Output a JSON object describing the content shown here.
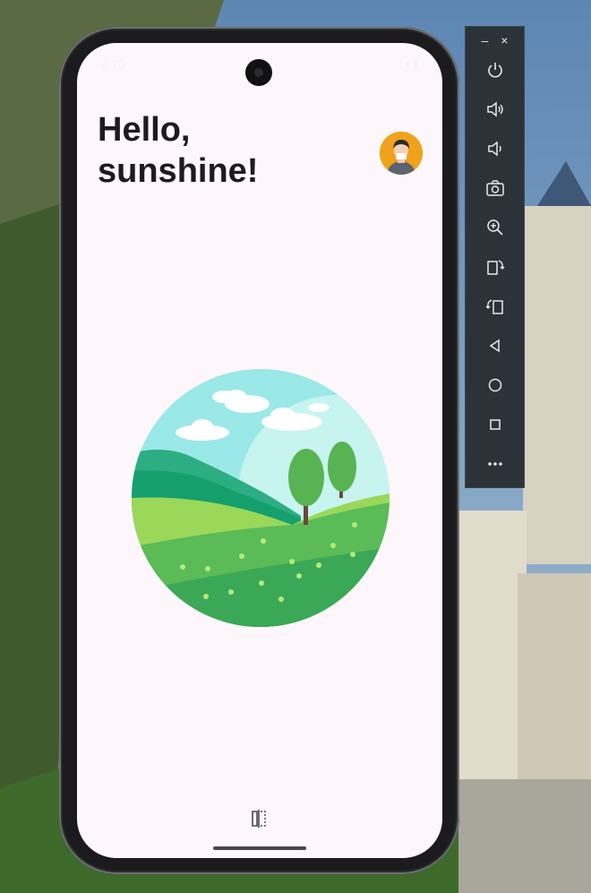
{
  "app": {
    "greeting": "Hello,\nsunshine!",
    "status_time": "4:20",
    "status_icons": "▾ ▮"
  },
  "colors": {
    "screen_background": "#fdf7fb",
    "avatar_bg": "#f0a21c",
    "toolbar_bg": "#2c3338"
  },
  "emulator_toolbar": {
    "window_controls": [
      "–",
      "×"
    ],
    "buttons": [
      {
        "icon": "power-icon"
      },
      {
        "icon": "volume-up-icon"
      },
      {
        "icon": "volume-down-icon"
      },
      {
        "icon": "camera-icon"
      },
      {
        "icon": "zoom-icon"
      },
      {
        "icon": "rotate-left-icon"
      },
      {
        "icon": "rotate-right-icon"
      },
      {
        "icon": "back-icon"
      },
      {
        "icon": "home-icon"
      },
      {
        "icon": "overview-icon"
      },
      {
        "icon": "more-icon"
      }
    ]
  }
}
